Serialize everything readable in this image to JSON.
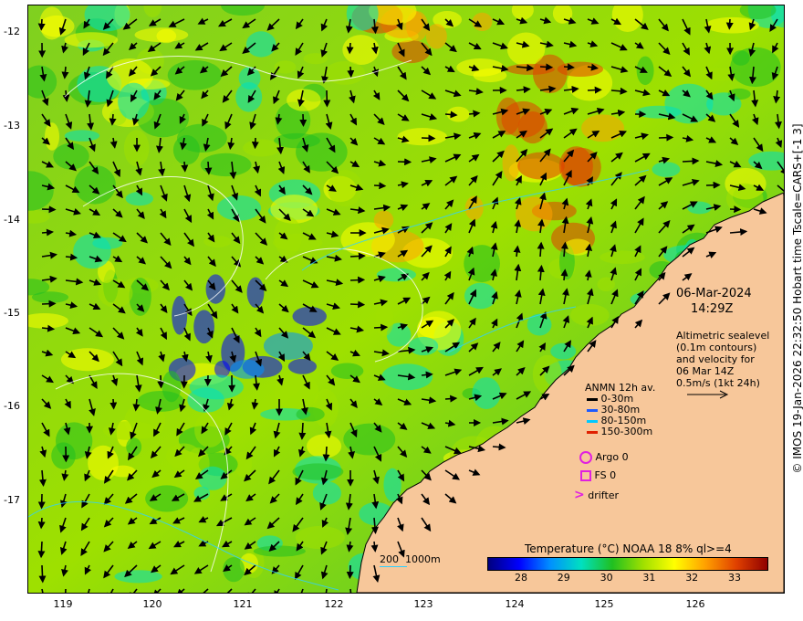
{
  "map": {
    "date": "06-Mar-2024",
    "time": "14:29Z",
    "notes": [
      "Altimetric sealevel",
      "(0.1m contours)",
      "and velocity for",
      "06 Mar 14Z",
      "0.5m/s (1kt 24h)"
    ],
    "side_caption": "© IMOS 19-Jan-2026 22:32:50 Hobart time Tscale=CARS+[-1 3]",
    "lat_ticks": [
      "-12",
      "-13",
      "-14",
      "-15",
      "-16",
      "-17"
    ],
    "lon_ticks": [
      "119",
      "120",
      "121",
      "122",
      "123",
      "124",
      "125",
      "126"
    ]
  },
  "anmn": {
    "title": "ANMN 12h av.",
    "items": [
      {
        "label": "0-30m",
        "color": "#000000"
      },
      {
        "label": "30-80m",
        "color": "#1e5bff"
      },
      {
        "label": "80-150m",
        "color": "#00c8ff"
      },
      {
        "label": "150-300m",
        "color": "#e02000"
      }
    ]
  },
  "markers": {
    "argo": "Argo 0",
    "fs": "FS 0",
    "drifter": "drifter",
    "color": "#e020e0"
  },
  "bathy": {
    "a": "200",
    "b": "1000m"
  },
  "colorbar": {
    "title": "Temperature (°C) NOAA 18 8% ql>=4",
    "ticks": [
      "28",
      "29",
      "30",
      "31",
      "32",
      "33"
    ],
    "colors": [
      "#00007f",
      "#0000ff",
      "#0090ff",
      "#00e0c0",
      "#20c020",
      "#a0e000",
      "#ffff00",
      "#ffa000",
      "#e04000",
      "#8f0000"
    ]
  }
}
